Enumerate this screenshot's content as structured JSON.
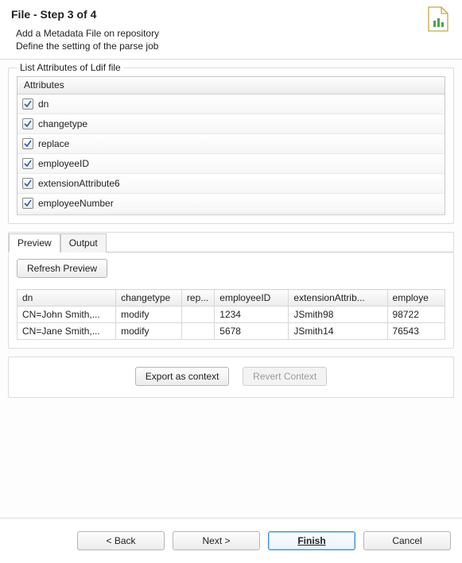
{
  "header": {
    "title": "File - Step 3 of 4",
    "line1": "Add a Metadata File on repository",
    "line2": "Define the setting of the parse job"
  },
  "attributes": {
    "group_label": "List Attributes of Ldif file",
    "header": "Attributes",
    "items": [
      {
        "label": "dn",
        "checked": true
      },
      {
        "label": "changetype",
        "checked": true
      },
      {
        "label": "replace",
        "checked": true
      },
      {
        "label": "employeeID",
        "checked": true
      },
      {
        "label": "extensionAttribute6",
        "checked": true
      },
      {
        "label": "employeeNumber",
        "checked": true
      }
    ]
  },
  "tabs": {
    "preview": "Preview",
    "output": "Output"
  },
  "preview": {
    "refresh": "Refresh Preview",
    "columns": [
      "dn",
      "changetype",
      "rep...",
      "employeeID",
      "extensionAttrib...",
      "employe"
    ],
    "rows": [
      [
        "CN=John Smith,...",
        "modify",
        "",
        "1234",
        "JSmith98",
        "98722"
      ],
      [
        "CN=Jane Smith,...",
        "modify",
        "",
        "5678",
        "JSmith14",
        "76543"
      ]
    ]
  },
  "context": {
    "export": "Export as context",
    "revert": "Revert Context"
  },
  "footer": {
    "back": "< Back",
    "next": "Next >",
    "finish": "Finish",
    "cancel": "Cancel"
  }
}
